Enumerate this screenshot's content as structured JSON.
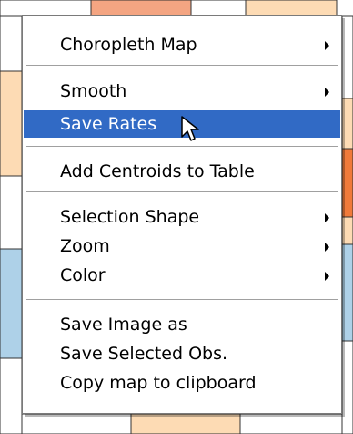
{
  "menu": {
    "items": [
      {
        "label": "Choropleth Map",
        "has_submenu": true
      },
      {
        "label": "Smooth",
        "has_submenu": true
      },
      {
        "label": "Save Rates",
        "has_submenu": false,
        "highlighted": true
      },
      {
        "label": "Add Centroids to Table",
        "has_submenu": false
      },
      {
        "label": "Selection Shape",
        "has_submenu": true
      },
      {
        "label": "Zoom",
        "has_submenu": true
      },
      {
        "label": "Color",
        "has_submenu": true
      },
      {
        "label": "Save Image as",
        "has_submenu": false
      },
      {
        "label": "Save Selected Obs.",
        "has_submenu": false
      },
      {
        "label": "Copy  map to clipboard",
        "has_submenu": false
      }
    ],
    "highlight_color": "#316ac5"
  },
  "map_colors": {
    "orange": "#f4a582",
    "peach": "#fddbb4",
    "light_blue": "#aed1e8",
    "deep_orange": "#f07a3a",
    "border": "#333333"
  },
  "icons": {
    "cursor": "arrow-cursor-icon",
    "submenu": "submenu-arrow-icon"
  }
}
